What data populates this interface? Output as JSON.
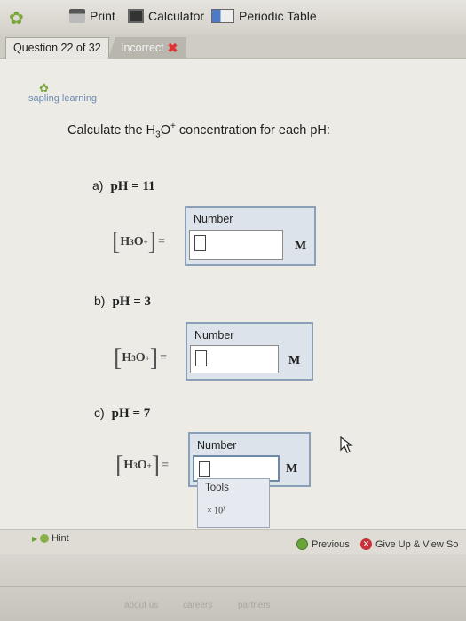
{
  "toolbar": {
    "print_label": "Print",
    "calculator_label": "Calculator",
    "periodic_table_label": "Periodic Table"
  },
  "question_bar": {
    "question_tab": "Question 22 of 32",
    "status": "Incorrect"
  },
  "brand": {
    "name": "sapling learning"
  },
  "prompt": {
    "text_before": "Calculate the H",
    "sub": "3",
    "mid": "O",
    "sup": "+",
    "text_after": " concentration for each pH:"
  },
  "parts": [
    {
      "letter": "a)",
      "equation": "pH = 11",
      "box_label": "Number",
      "value": "",
      "unit": "M"
    },
    {
      "letter": "b)",
      "equation": "pH = 3",
      "box_label": "Number",
      "value": "",
      "unit": "M"
    },
    {
      "letter": "c)",
      "equation": "pH = 7",
      "box_label": "Number",
      "value": "",
      "unit": "M"
    }
  ],
  "concentration_expr": {
    "h": "H",
    "sub": "3",
    "o": "O",
    "sup": "+",
    "equals": "="
  },
  "tools_popup": {
    "label": "Tools",
    "sci_notation": "× 10",
    "sci_sup": "y"
  },
  "footer": {
    "hint_label": "Hint",
    "previous_label": "Previous",
    "give_up_label": "Give Up & View So"
  },
  "bottom_links": [
    "about us",
    "careers",
    "partners"
  ],
  "colors": {
    "accent_green": "#6aa33a",
    "incorrect_red": "#d33333",
    "box_border": "#8aa0b8"
  }
}
